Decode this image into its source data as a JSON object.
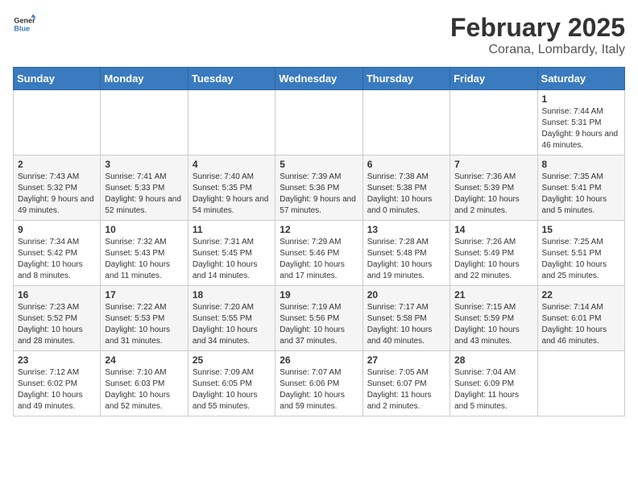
{
  "header": {
    "logo_general": "General",
    "logo_blue": "Blue",
    "title": "February 2025",
    "subtitle": "Corana, Lombardy, Italy"
  },
  "weekdays": [
    "Sunday",
    "Monday",
    "Tuesday",
    "Wednesday",
    "Thursday",
    "Friday",
    "Saturday"
  ],
  "weeks": [
    [
      {
        "day": "",
        "info": ""
      },
      {
        "day": "",
        "info": ""
      },
      {
        "day": "",
        "info": ""
      },
      {
        "day": "",
        "info": ""
      },
      {
        "day": "",
        "info": ""
      },
      {
        "day": "",
        "info": ""
      },
      {
        "day": "1",
        "info": "Sunrise: 7:44 AM\nSunset: 5:31 PM\nDaylight: 9 hours and 46 minutes."
      }
    ],
    [
      {
        "day": "2",
        "info": "Sunrise: 7:43 AM\nSunset: 5:32 PM\nDaylight: 9 hours and 49 minutes."
      },
      {
        "day": "3",
        "info": "Sunrise: 7:41 AM\nSunset: 5:33 PM\nDaylight: 9 hours and 52 minutes."
      },
      {
        "day": "4",
        "info": "Sunrise: 7:40 AM\nSunset: 5:35 PM\nDaylight: 9 hours and 54 minutes."
      },
      {
        "day": "5",
        "info": "Sunrise: 7:39 AM\nSunset: 5:36 PM\nDaylight: 9 hours and 57 minutes."
      },
      {
        "day": "6",
        "info": "Sunrise: 7:38 AM\nSunset: 5:38 PM\nDaylight: 10 hours and 0 minutes."
      },
      {
        "day": "7",
        "info": "Sunrise: 7:36 AM\nSunset: 5:39 PM\nDaylight: 10 hours and 2 minutes."
      },
      {
        "day": "8",
        "info": "Sunrise: 7:35 AM\nSunset: 5:41 PM\nDaylight: 10 hours and 5 minutes."
      }
    ],
    [
      {
        "day": "9",
        "info": "Sunrise: 7:34 AM\nSunset: 5:42 PM\nDaylight: 10 hours and 8 minutes."
      },
      {
        "day": "10",
        "info": "Sunrise: 7:32 AM\nSunset: 5:43 PM\nDaylight: 10 hours and 11 minutes."
      },
      {
        "day": "11",
        "info": "Sunrise: 7:31 AM\nSunset: 5:45 PM\nDaylight: 10 hours and 14 minutes."
      },
      {
        "day": "12",
        "info": "Sunrise: 7:29 AM\nSunset: 5:46 PM\nDaylight: 10 hours and 17 minutes."
      },
      {
        "day": "13",
        "info": "Sunrise: 7:28 AM\nSunset: 5:48 PM\nDaylight: 10 hours and 19 minutes."
      },
      {
        "day": "14",
        "info": "Sunrise: 7:26 AM\nSunset: 5:49 PM\nDaylight: 10 hours and 22 minutes."
      },
      {
        "day": "15",
        "info": "Sunrise: 7:25 AM\nSunset: 5:51 PM\nDaylight: 10 hours and 25 minutes."
      }
    ],
    [
      {
        "day": "16",
        "info": "Sunrise: 7:23 AM\nSunset: 5:52 PM\nDaylight: 10 hours and 28 minutes."
      },
      {
        "day": "17",
        "info": "Sunrise: 7:22 AM\nSunset: 5:53 PM\nDaylight: 10 hours and 31 minutes."
      },
      {
        "day": "18",
        "info": "Sunrise: 7:20 AM\nSunset: 5:55 PM\nDaylight: 10 hours and 34 minutes."
      },
      {
        "day": "19",
        "info": "Sunrise: 7:19 AM\nSunset: 5:56 PM\nDaylight: 10 hours and 37 minutes."
      },
      {
        "day": "20",
        "info": "Sunrise: 7:17 AM\nSunset: 5:58 PM\nDaylight: 10 hours and 40 minutes."
      },
      {
        "day": "21",
        "info": "Sunrise: 7:15 AM\nSunset: 5:59 PM\nDaylight: 10 hours and 43 minutes."
      },
      {
        "day": "22",
        "info": "Sunrise: 7:14 AM\nSunset: 6:01 PM\nDaylight: 10 hours and 46 minutes."
      }
    ],
    [
      {
        "day": "23",
        "info": "Sunrise: 7:12 AM\nSunset: 6:02 PM\nDaylight: 10 hours and 49 minutes."
      },
      {
        "day": "24",
        "info": "Sunrise: 7:10 AM\nSunset: 6:03 PM\nDaylight: 10 hours and 52 minutes."
      },
      {
        "day": "25",
        "info": "Sunrise: 7:09 AM\nSunset: 6:05 PM\nDaylight: 10 hours and 55 minutes."
      },
      {
        "day": "26",
        "info": "Sunrise: 7:07 AM\nSunset: 6:06 PM\nDaylight: 10 hours and 59 minutes."
      },
      {
        "day": "27",
        "info": "Sunrise: 7:05 AM\nSunset: 6:07 PM\nDaylight: 11 hours and 2 minutes."
      },
      {
        "day": "28",
        "info": "Sunrise: 7:04 AM\nSunset: 6:09 PM\nDaylight: 11 hours and 5 minutes."
      },
      {
        "day": "",
        "info": ""
      }
    ]
  ]
}
